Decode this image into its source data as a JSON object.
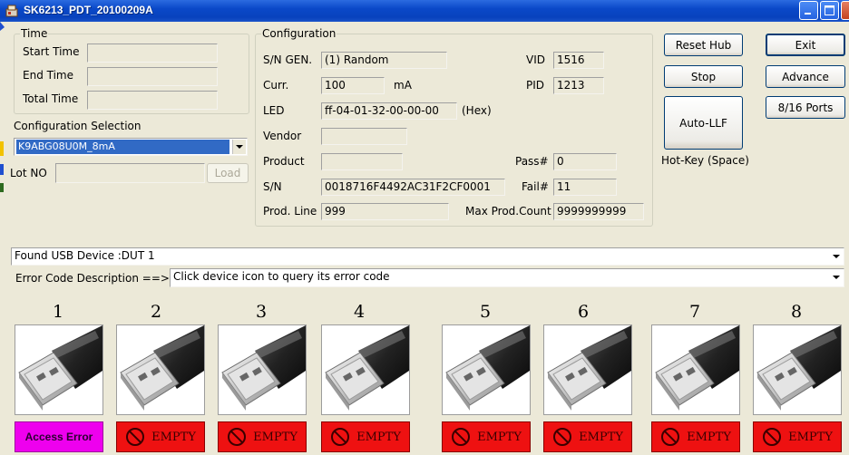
{
  "window": {
    "title": "SK6213_PDT_20100209A"
  },
  "time_group": {
    "legend": "Time",
    "start_label": "Start Time",
    "start_value": "",
    "end_label": "End Time",
    "end_value": "",
    "total_label": "Total Time",
    "total_value": ""
  },
  "config_selection": {
    "label": "Configuration Selection",
    "value": "K9ABG08U0M_8mA"
  },
  "lot": {
    "label": "Lot NO",
    "value": "",
    "load_button": "Load"
  },
  "configuration": {
    "legend": "Configuration",
    "sn_gen_label": "S/N GEN.",
    "sn_gen_value": "(1) Random",
    "curr_label": "Curr.",
    "curr_value": "100",
    "curr_unit": "mA",
    "led_label": "LED",
    "led_value": "ff-04-01-32-00-00-00",
    "led_unit": "(Hex)",
    "vendor_label": "Vendor",
    "vendor_value": "",
    "product_label": "Product",
    "product_value": "",
    "sn_label": "S/N",
    "sn_value": "0018716F4492AC31F2CF0001",
    "prod_line_label": "Prod. Line",
    "prod_line_value": "999",
    "vid_label": "VID",
    "vid_value": "1516",
    "pid_label": "PID",
    "pid_value": "1213",
    "pass_label": "Pass#",
    "pass_value": "0",
    "fail_label": "Fail#",
    "fail_value": "11",
    "max_label": "Max Prod.Count",
    "max_value": "9999999999"
  },
  "buttons": {
    "reset_hub": "Reset Hub",
    "stop": "Stop",
    "auto_llf": "Auto-LLF",
    "hotkey": "Hot-Key (Space)",
    "exit": "Exit",
    "advance": "Advance",
    "ports": "8/16 Ports"
  },
  "found_device": {
    "value": "Found USB Device :DUT 1"
  },
  "error_code": {
    "label": "Error Code Description ==>",
    "value": "Click device icon to query its error code"
  },
  "ports": [
    {
      "number": "1",
      "status": "Access Error",
      "kind": "error"
    },
    {
      "number": "2",
      "status": "EMPTY",
      "kind": "empty"
    },
    {
      "number": "3",
      "status": "EMPTY",
      "kind": "empty"
    },
    {
      "number": "4",
      "status": "EMPTY",
      "kind": "empty"
    },
    {
      "number": "5",
      "status": "EMPTY",
      "kind": "empty"
    },
    {
      "number": "6",
      "status": "EMPTY",
      "kind": "empty"
    },
    {
      "number": "7",
      "status": "EMPTY",
      "kind": "empty"
    },
    {
      "number": "8",
      "status": "EMPTY",
      "kind": "empty"
    }
  ],
  "colors": {
    "error": "#ee00ee",
    "empty": "#ee1111",
    "selection": "#316ac5"
  }
}
